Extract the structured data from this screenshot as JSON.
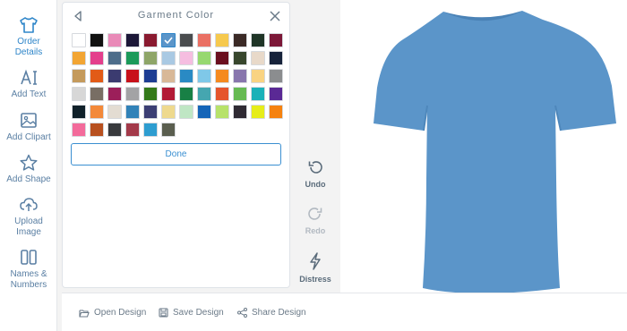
{
  "sidebar": {
    "items": [
      {
        "label1": "Order",
        "label2": "Details"
      },
      {
        "label1": "Add Text",
        "label2": ""
      },
      {
        "label1": "Add Clipart",
        "label2": ""
      },
      {
        "label1": "Add Shape",
        "label2": ""
      },
      {
        "label1": "Upload",
        "label2": "Image"
      },
      {
        "label1": "Names &",
        "label2": "Numbers"
      }
    ]
  },
  "panel": {
    "title": "Garment Color",
    "done_label": "Done",
    "selected_index": 5,
    "colors": [
      "#ffffff",
      "#111111",
      "#e98ab8",
      "#1c1838",
      "#8a1a30",
      "#5b95c9",
      "#4a4d4f",
      "#ea7064",
      "#f6c94e",
      "#3b2a26",
      "#1f3527",
      "#7c1838",
      "#f2a533",
      "#e43f8c",
      "#4d6d8a",
      "#1b9a5a",
      "#8ea568",
      "#a9c9e3",
      "#f5bde0",
      "#97d870",
      "#6a0f1f",
      "#38472d",
      "#e8d9c9",
      "#17233b",
      "#c49a5c",
      "#e25b17",
      "#3b3b70",
      "#c8111a",
      "#1d3d93",
      "#d8b898",
      "#2a8ac4",
      "#7fc8e8",
      "#f58a1f",
      "#8876ad",
      "#f9d382",
      "#8b8d8f",
      "#d7d7d7",
      "#786e64",
      "#9c1f5a",
      "#a3a3a5",
      "#347a1a",
      "#b21a36",
      "#188045",
      "#45a6b0",
      "#e5552c",
      "#66ba52",
      "#1bb1b8",
      "#5a2995",
      "#10212a",
      "#f3893a",
      "#e3dcd2",
      "#3182b8",
      "#3c3f74",
      "#eed98e",
      "#bfe6c4",
      "#1565b8",
      "#b7e26a",
      "#2f2a33",
      "#e6ed1a",
      "#f5820f",
      "#f36b9b",
      "#b8501f",
      "#383a3d",
      "#a33a4a",
      "#2e9dd0",
      "#5a5e4f"
    ]
  },
  "tools": {
    "undo": "Undo",
    "redo": "Redo",
    "distress": "Distress"
  },
  "bottom": {
    "open": "Open Design",
    "save": "Save Design",
    "share": "Share Design"
  },
  "shirt": {
    "color": "#5b95c9"
  }
}
